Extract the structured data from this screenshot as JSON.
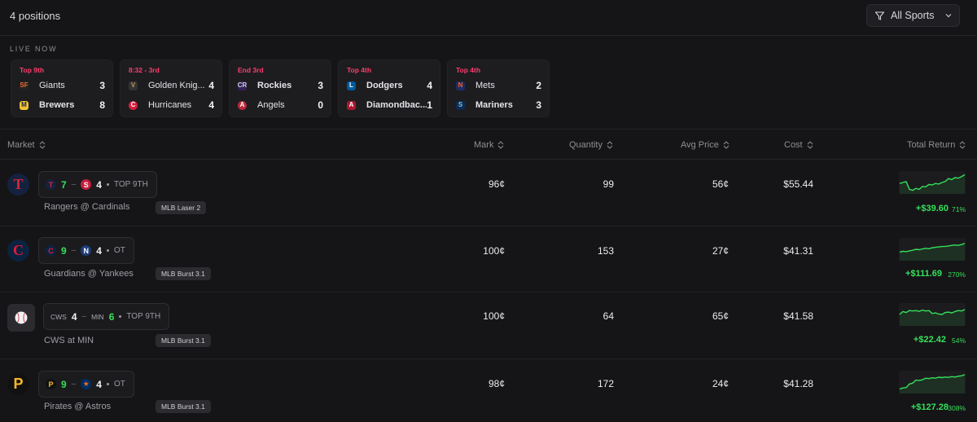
{
  "header": {
    "positions_count": "4 positions",
    "sports_filter": "All Sports"
  },
  "live": {
    "label": "LIVE NOW",
    "games": [
      {
        "status": "Top 9th",
        "team1": {
          "name": "Giants",
          "score": "3",
          "logo": "SF",
          "color": "#f06c2a",
          "bold": false
        },
        "team2": {
          "name": "Brewers",
          "score": "8",
          "logo": "M",
          "color": "#f2c230",
          "bold": true
        }
      },
      {
        "status": "8:32 - 3rd",
        "team1": {
          "name": "Golden Knig...",
          "score": "4",
          "logo": "VG",
          "color": "#b9975b",
          "bold": false
        },
        "team2": {
          "name": "Hurricanes",
          "score": "4",
          "logo": "C",
          "color": "#d81e3c",
          "bold": false
        }
      },
      {
        "status": "End 3rd",
        "team1": {
          "name": "Rockies",
          "score": "3",
          "logo": "CR",
          "color": "#cfcfcf",
          "bold": true
        },
        "team2": {
          "name": "Angels",
          "score": "0",
          "logo": "A",
          "color": "#ba2a39",
          "bold": false
        }
      },
      {
        "status": "Top 4th",
        "team1": {
          "name": "Dodgers",
          "score": "4",
          "logo": "LA",
          "color": "#3a7bd5",
          "bold": true
        },
        "team2": {
          "name": "Diamondbac...",
          "score": "1",
          "logo": "A",
          "color": "#b3263b",
          "bold": false
        }
      },
      {
        "status": "Top 4th",
        "team1": {
          "name": "Mets",
          "score": "2",
          "logo": "NY",
          "color": "#6f5bd4",
          "bold": false
        },
        "team2": {
          "name": "Mariners",
          "score": "3",
          "logo": "S",
          "color": "#7fc0c8",
          "bold": true
        }
      }
    ]
  },
  "table": {
    "columns": {
      "market": "Market",
      "mark": "Mark",
      "quantity": "Quantity",
      "avg_price": "Avg Price",
      "cost": "Cost",
      "total_return": "Total Return"
    },
    "rows": [
      {
        "badge": "T",
        "badge_color": "#d0273a",
        "badge_bg": "#15223f",
        "home": {
          "logo": "T",
          "logo_color": "#d0273a",
          "logo_bg": "#15223f",
          "score": "7",
          "win": true
        },
        "away": {
          "logo": "StL",
          "logo_color": "#ffffff",
          "logo_bg": "#c41e3a",
          "score": "4",
          "win": false
        },
        "period": "TOP 9TH",
        "matchup": "Rangers @ Cardinals",
        "model": "MLB Laser 2",
        "mark": "96¢",
        "quantity": "99",
        "avg_price": "56¢",
        "cost": "$55.44",
        "return_abs": "+$39.60",
        "return_pct": "71%",
        "trend": [
          0.55,
          0.5,
          0.45,
          0.85,
          0.9,
          0.8,
          0.85,
          0.7,
          0.72,
          0.6,
          0.62,
          0.55,
          0.58,
          0.5,
          0.45,
          0.3,
          0.35,
          0.25,
          0.28,
          0.2,
          0.1
        ]
      },
      {
        "badge": "C",
        "badge_color": "#e31937",
        "badge_bg": "#0c2340",
        "home": {
          "logo": "C",
          "logo_color": "#e31937",
          "logo_bg": "#0c2340",
          "score": "9",
          "win": true
        },
        "away": {
          "logo": "NY",
          "logo_color": "#ffffff",
          "logo_bg": "#1c3c78",
          "score": "4",
          "win": false
        },
        "period": "OT",
        "matchup": "Guardians @ Yankees",
        "model": "MLB Burst 3.1",
        "mark": "100¢",
        "quantity": "153",
        "avg_price": "27¢",
        "cost": "$41.31",
        "return_abs": "+$111.69",
        "return_pct": "270%",
        "trend": [
          0.65,
          0.6,
          0.62,
          0.58,
          0.55,
          0.5,
          0.52,
          0.48,
          0.45,
          0.47,
          0.42,
          0.4,
          0.38,
          0.36,
          0.35,
          0.33,
          0.3,
          0.28,
          0.3,
          0.26,
          0.2
        ]
      },
      {
        "badge": "⚾",
        "badge_color": "#c9c9cf",
        "badge_bg": "#2a2a2f",
        "home": {
          "abbr": "CWS",
          "score": "4",
          "win": false
        },
        "away": {
          "abbr": "MIN",
          "score": "6",
          "win": true
        },
        "period": "TOP 9TH",
        "matchup": "CWS at MIN",
        "model": "MLB Burst 3.1",
        "mark": "100¢",
        "quantity": "64",
        "avg_price": "65¢",
        "cost": "$41.58",
        "return_abs": "+$22.42",
        "return_pct": "54%",
        "trend": [
          0.5,
          0.35,
          0.4,
          0.3,
          0.32,
          0.3,
          0.34,
          0.28,
          0.32,
          0.3,
          0.45,
          0.42,
          0.48,
          0.5,
          0.4,
          0.38,
          0.42,
          0.35,
          0.3,
          0.32,
          0.25
        ]
      },
      {
        "badge": "P",
        "badge_color": "#fdb827",
        "badge_bg": "#111111",
        "home": {
          "logo": "P",
          "logo_color": "#fdb827",
          "logo_bg": "#111111",
          "score": "9",
          "win": true
        },
        "away": {
          "logo": "H",
          "logo_color": "#eb6e1f",
          "logo_bg": "#002d62",
          "score": "4",
          "win": false
        },
        "period": "OT",
        "matchup": "Pirates @ Astros",
        "model": "MLB Burst 3.1",
        "mark": "98¢",
        "quantity": "172",
        "avg_price": "24¢",
        "cost": "$41.28",
        "return_abs": "+$127.28",
        "return_pct": "308%",
        "trend": [
          0.85,
          0.8,
          0.78,
          0.6,
          0.55,
          0.4,
          0.42,
          0.38,
          0.3,
          0.32,
          0.28,
          0.3,
          0.25,
          0.27,
          0.24,
          0.26,
          0.22,
          0.24,
          0.2,
          0.18,
          0.12
        ]
      }
    ]
  },
  "colors": {
    "positive": "#35e05b",
    "live_status": "#ff3d6b",
    "background": "#151517"
  },
  "icons": {
    "filter": "filter-icon",
    "chevron": "chevron-down-icon",
    "sort": "sort-icon"
  }
}
